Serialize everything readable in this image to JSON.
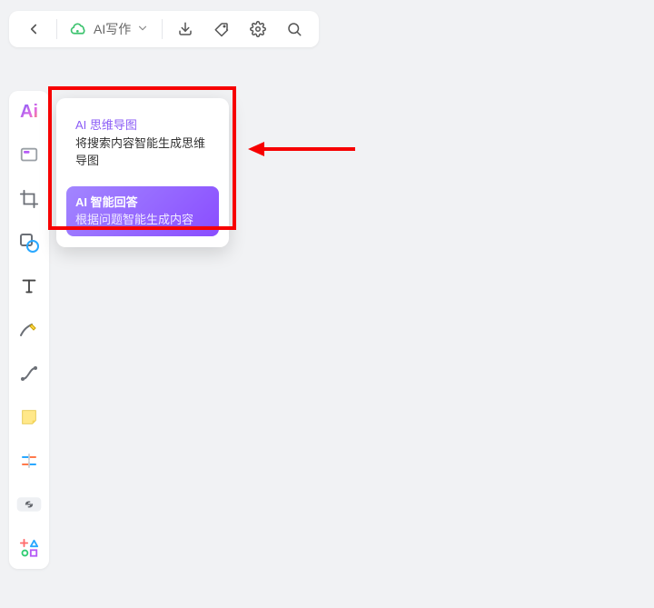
{
  "toolbar": {
    "ai_write_label": "AI写作"
  },
  "ai_menu": {
    "mindmap": {
      "title": "AI 思维导图",
      "desc": "将搜索内容智能生成思维导图"
    },
    "answer": {
      "title": "AI 智能回答",
      "desc": "根据问题智能生成内容"
    }
  }
}
